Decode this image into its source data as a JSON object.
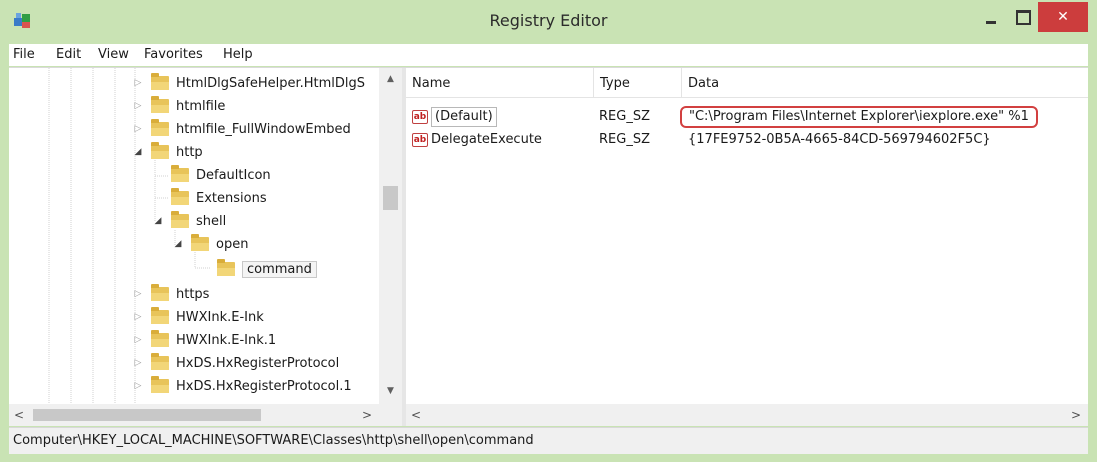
{
  "window": {
    "title": "Registry Editor",
    "accent": "#c9e3b4",
    "close_glyph": "✕",
    "close_color": "#cc3d3d"
  },
  "menu": {
    "items": [
      {
        "label": "File"
      },
      {
        "label": "Edit"
      },
      {
        "label": "View"
      },
      {
        "label": "Favorites"
      },
      {
        "label": "Help"
      }
    ]
  },
  "tree": {
    "items": [
      {
        "label": "HtmlDlgSafeHelper.HtmlDlgS",
        "expander": "▷",
        "expanded": false
      },
      {
        "label": "htmlfile",
        "expander": "▷",
        "expanded": false
      },
      {
        "label": "htmlfile_FullWindowEmbed",
        "expander": "▷",
        "expanded": false
      },
      {
        "label": "http",
        "expander": "◢",
        "expanded": true
      },
      {
        "label": "DefaultIcon",
        "expander": "",
        "expanded": false
      },
      {
        "label": "Extensions",
        "expander": "",
        "expanded": false
      },
      {
        "label": "shell",
        "expander": "◢",
        "expanded": true
      },
      {
        "label": "open",
        "expander": "◢",
        "expanded": true
      },
      {
        "label": "command",
        "expander": "",
        "expanded": false,
        "selected": true
      },
      {
        "label": "https",
        "expander": "▷",
        "expanded": false
      },
      {
        "label": "HWXInk.E-Ink",
        "expander": "▷",
        "expanded": false
      },
      {
        "label": "HWXInk.E-Ink.1",
        "expander": "▷",
        "expanded": false
      },
      {
        "label": "HxDS.HxRegisterProtocol",
        "expander": "▷",
        "expanded": false
      },
      {
        "label": "HxDS.HxRegisterProtocol.1",
        "expander": "▷",
        "expanded": false
      }
    ]
  },
  "list": {
    "columns": {
      "name": "Name",
      "type": "Type",
      "data": "Data"
    },
    "rows": [
      {
        "name": "(Default)",
        "type": "REG_SZ",
        "data": "\"C:\\Program Files\\Internet Explorer\\iexplore.exe\" %1",
        "icon": "string-value-icon",
        "icon_text": "ab"
      },
      {
        "name": "DelegateExecute",
        "type": "REG_SZ",
        "data": "{17FE9752-0B5A-4665-84CD-569794602F5C}",
        "icon": "string-value-icon",
        "icon_text": "ab"
      }
    ]
  },
  "status": {
    "path": "Computer\\HKEY_LOCAL_MACHINE\\SOFTWARE\\Classes\\http\\shell\\open\\command"
  },
  "scrollbars": {
    "up": "▲",
    "down": "▼",
    "left": "<",
    "right": ">"
  }
}
